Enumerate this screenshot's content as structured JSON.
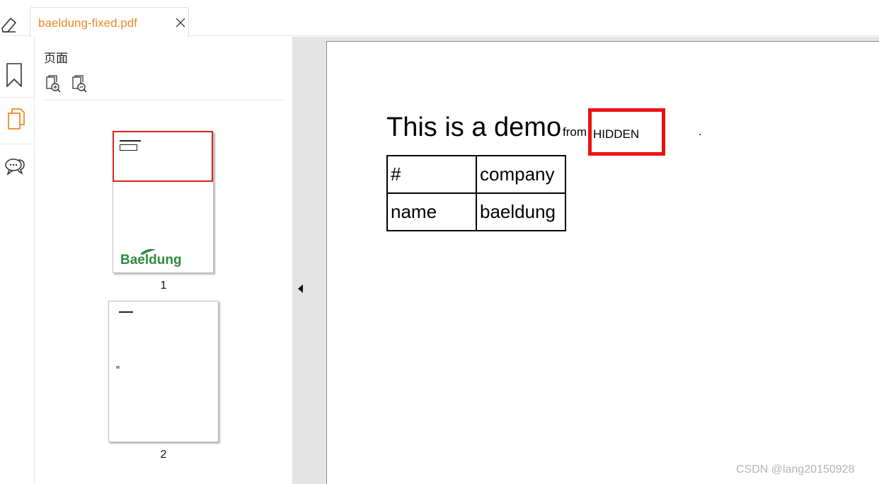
{
  "tab": {
    "filename": "baeldung-fixed.pdf"
  },
  "panel": {
    "title": "页面",
    "tools": [
      "zoom-in-page-icon",
      "zoom-out-page-icon"
    ],
    "thumbnails": [
      {
        "page_number": "1",
        "logo_text": "Baeldung",
        "selected": true
      },
      {
        "page_number": "2",
        "selected": false
      }
    ]
  },
  "rail": {
    "items": [
      "bookmark-icon",
      "pages-icon",
      "comment-icon"
    ],
    "active": "pages-icon"
  },
  "document": {
    "heading": "This is a demo",
    "from": "from",
    "hidden": "HIDDEN",
    "dot": ".",
    "table": [
      [
        "#",
        "company"
      ],
      [
        "name",
        "baeldung"
      ]
    ]
  },
  "colors": {
    "accent": "#f08a24",
    "highlight_red": "#ee1111",
    "logo_green": "#2e8b3a",
    "gutter": "#e4e4e4"
  },
  "watermark": "CSDN @lang20150928"
}
